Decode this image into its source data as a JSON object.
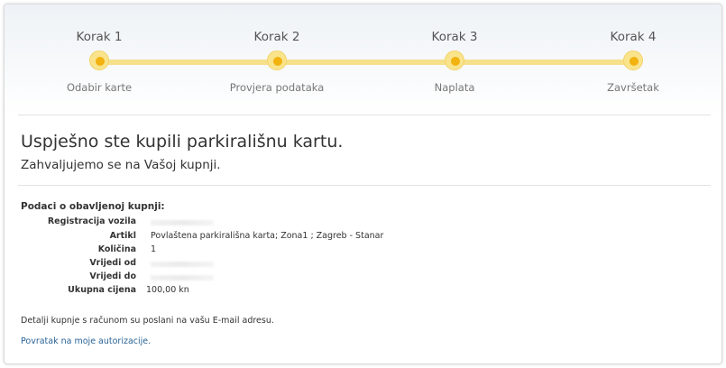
{
  "steps": [
    {
      "title": "Korak 1",
      "label": "Odabir karte"
    },
    {
      "title": "Korak 2",
      "label": "Provjera podataka"
    },
    {
      "title": "Korak 3",
      "label": "Naplata"
    },
    {
      "title": "Korak 4",
      "label": "Završetak"
    }
  ],
  "success": {
    "title": "Uspješno ste kupili parkirališnu kartu.",
    "subtitle": "Zahvaljujemo se na Vašoj kupnji."
  },
  "details": {
    "heading": "Podaci o obavljenoj kupnji:",
    "rows": [
      {
        "label": "Registracija vozila",
        "value": ""
      },
      {
        "label": "Artikl",
        "value": "Povlaštena parkirališna karta; Zona1 ; Zagreb - Stanar"
      },
      {
        "label": "Količina",
        "value": "1"
      },
      {
        "label": "Vrijedi od",
        "value": ""
      },
      {
        "label": "Vrijedi do",
        "value": ""
      },
      {
        "label": "Ukupna cijena",
        "value": "100,00 kn"
      }
    ]
  },
  "note": "Detalji kupnje s računom su poslani na vašu E-mail adresu.",
  "back_link": "Povratak na moje autorizacije."
}
